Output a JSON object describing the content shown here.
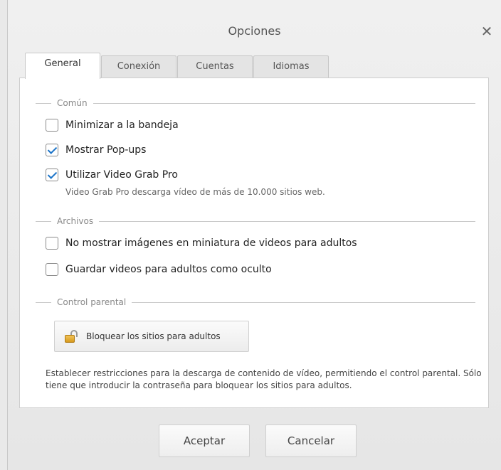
{
  "window": {
    "title": "Opciones",
    "close_glyph": "✕"
  },
  "tabs": [
    {
      "label": "General",
      "active": true
    },
    {
      "label": "Conexión",
      "active": false
    },
    {
      "label": "Cuentas",
      "active": false
    },
    {
      "label": "Idiomas",
      "active": false
    }
  ],
  "sections": {
    "common": "Común",
    "files": "Archivos",
    "parental": "Control parental"
  },
  "options": {
    "minimize": {
      "label": "Minimizar a la bandeja",
      "checked": false
    },
    "popups": {
      "label": "Mostrar Pop-ups",
      "checked": true
    },
    "grabpro": {
      "label": "Utilizar Video Grab Pro",
      "checked": true,
      "description": "Video Grab Pro descarga vídeo de más de 10.000 sitios web."
    },
    "no_thumbs": {
      "label": "No mostrar imágenes en miniatura de videos para adultos",
      "checked": false
    },
    "hidden": {
      "label": "Guardar videos para adultos como oculto",
      "checked": false
    }
  },
  "parental": {
    "button_label": "Bloquear los sitios para adultos",
    "button_icon": "padlock-open-icon",
    "description": "Establecer restricciones para la descarga de contenido de vídeo, permitiendo el control parental. Sólo tiene que introducir la contraseña para bloquear los sitios para adultos."
  },
  "buttons": {
    "ok": "Aceptar",
    "cancel": "Cancelar"
  },
  "colors": {
    "check_accent": "#1a73c8",
    "lock_gold": "#e3aa2e"
  }
}
